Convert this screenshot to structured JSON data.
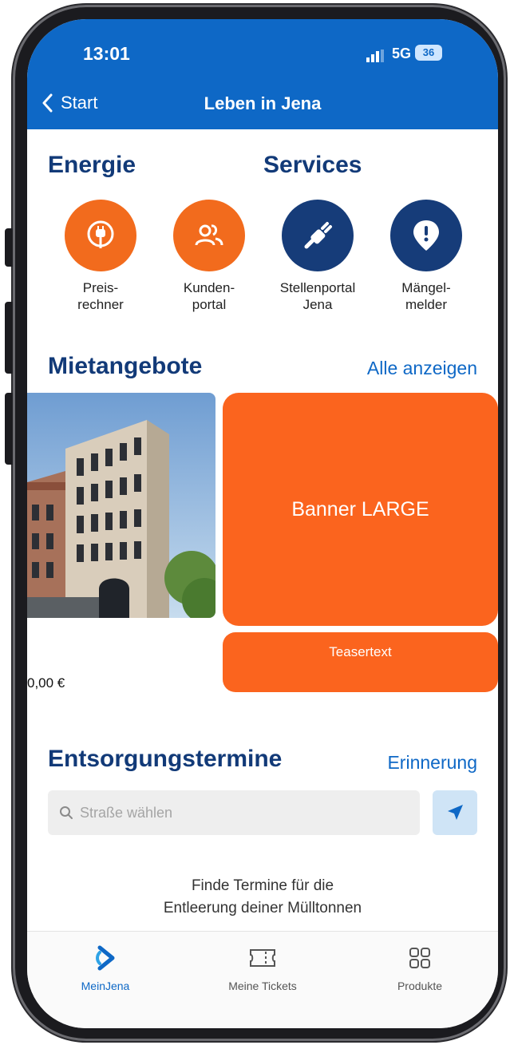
{
  "status_bar": {
    "time": "13:01",
    "network": "5G",
    "battery": "36"
  },
  "nav": {
    "back_label": "Start",
    "title": "Leben in Jena"
  },
  "energie": {
    "title": "Energie"
  },
  "services": {
    "title": "Services"
  },
  "tiles": [
    {
      "label": "Preis-\nrechner",
      "icon": "plug-icon",
      "color": "#f26b1d"
    },
    {
      "label": "Kunden-\nportal",
      "icon": "users-icon",
      "color": "#f26b1d"
    },
    {
      "label": "Stellenportal\nJena",
      "icon": "plug-wrench-icon",
      "color": "#163c79"
    },
    {
      "label": "Mängel-\nmelder",
      "icon": "exclamation-pin-icon",
      "color": "#163c79"
    }
  ],
  "mietangebote": {
    "title": "Mietangebote",
    "link": "Alle anzeigen",
    "listing_price": "0,00 €"
  },
  "banner": {
    "text": "Banner LARGE",
    "teaser": "Teasertext"
  },
  "entsorgung": {
    "title": "Entsorgungstermine",
    "link": "Erinnerung",
    "search_placeholder": "Straße wählen",
    "info_line1": "Finde Termine für die",
    "info_line2": "Entleerung deiner Mülltonnen"
  },
  "tabbar": [
    {
      "label": "MeinJena",
      "icon": "meinjena-logo-icon",
      "active": true
    },
    {
      "label": "Meine Tickets",
      "icon": "ticket-icon",
      "active": false
    },
    {
      "label": "Produkte",
      "icon": "grid-icon",
      "active": false
    }
  ],
  "colors": {
    "brand_blue": "#0e68c6",
    "navy": "#163c79",
    "orange": "#f26b1d",
    "banner_orange": "#fb641e"
  }
}
